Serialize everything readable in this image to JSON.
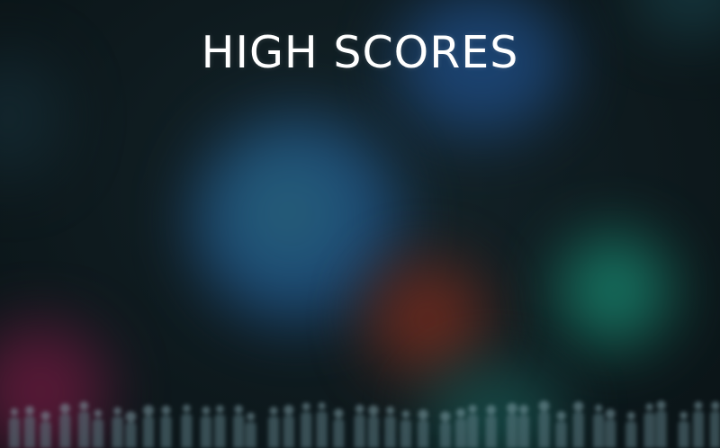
{
  "screen": {
    "title": "HIGH SCORES"
  },
  "colors": {
    "background": "#0c1518",
    "title_text": "#ffffff",
    "bokeh_blue": "#1f4f8a",
    "bokeh_teal": "#177a66",
    "bokeh_red": "#6e2a1e",
    "bokeh_magenta": "#6a1a3e"
  }
}
